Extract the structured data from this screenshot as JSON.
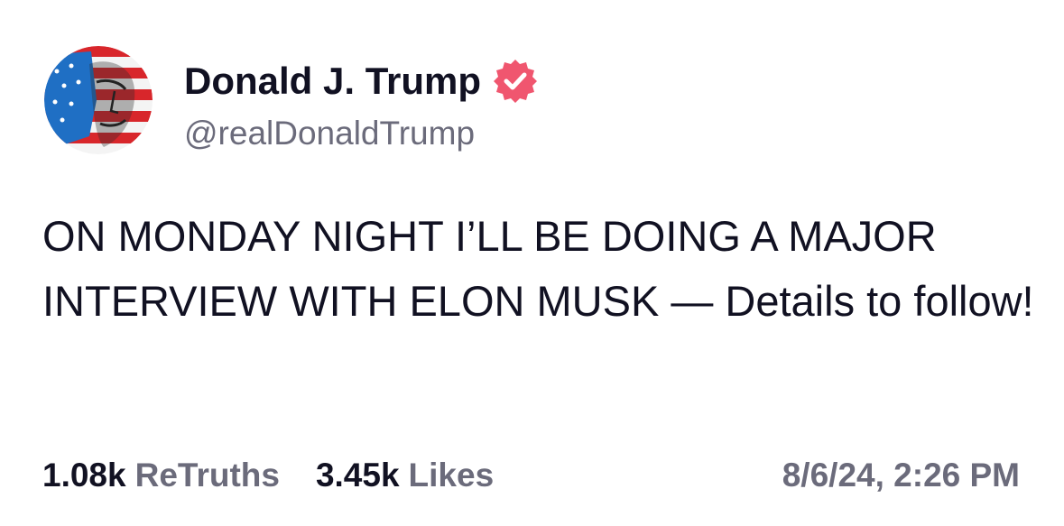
{
  "author": {
    "name": "Donald J. Trump",
    "handle": "@realDonaldTrump",
    "verified": true,
    "verified_color": "#f0566f",
    "avatar_icon": "flag-portrait-avatar"
  },
  "post": {
    "text": "ON MONDAY NIGHT I’LL BE DOING A MAJOR INTERVIEW WITH ELON MUSK — Details to follow!"
  },
  "stats": {
    "retruths_count": "1.08k",
    "retruths_label": "ReTruths",
    "likes_count": "3.45k",
    "likes_label": "Likes"
  },
  "timestamp": "8/6/24, 2:26 PM",
  "colors": {
    "text_primary": "#111122",
    "text_secondary": "#6b6b7b",
    "background": "#ffffff"
  }
}
